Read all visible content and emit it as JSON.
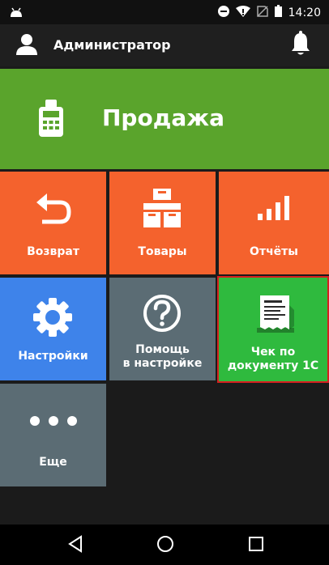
{
  "status": {
    "time": "14:20"
  },
  "appbar": {
    "title": "Администратор"
  },
  "sale": {
    "label": "Продажа"
  },
  "tiles": {
    "return": {
      "label": "Возврат"
    },
    "goods": {
      "label": "Товары"
    },
    "reports": {
      "label": "Отчёты"
    },
    "settings": {
      "label": "Настройки"
    },
    "help": {
      "line1": "Помощь",
      "line2": "в настройке"
    },
    "receipt": {
      "line1": "Чек по",
      "line2": "документу 1С"
    },
    "more": {
      "label": "Еще"
    }
  },
  "icons": {
    "statusbar": [
      "android-icon",
      "minus-circle-icon",
      "wifi-icon",
      "no-sim-icon",
      "battery-icon"
    ],
    "appbar": [
      "user-icon",
      "bell-icon"
    ],
    "tiles": [
      "pos-terminal-icon",
      "undo-arrow-icon",
      "boxes-icon",
      "bar-chart-icon",
      "gear-icon",
      "question-icon",
      "receipt-icon",
      "more-dots-icon"
    ],
    "navbar": [
      "back-icon",
      "home-icon",
      "recents-icon"
    ]
  },
  "colors": {
    "sale": "#5aa42c",
    "orange": "#f4622d",
    "blue": "#3e83ea",
    "slate": "#5b6c74",
    "green": "#2fba3e",
    "highlight_border": "#d62020"
  }
}
